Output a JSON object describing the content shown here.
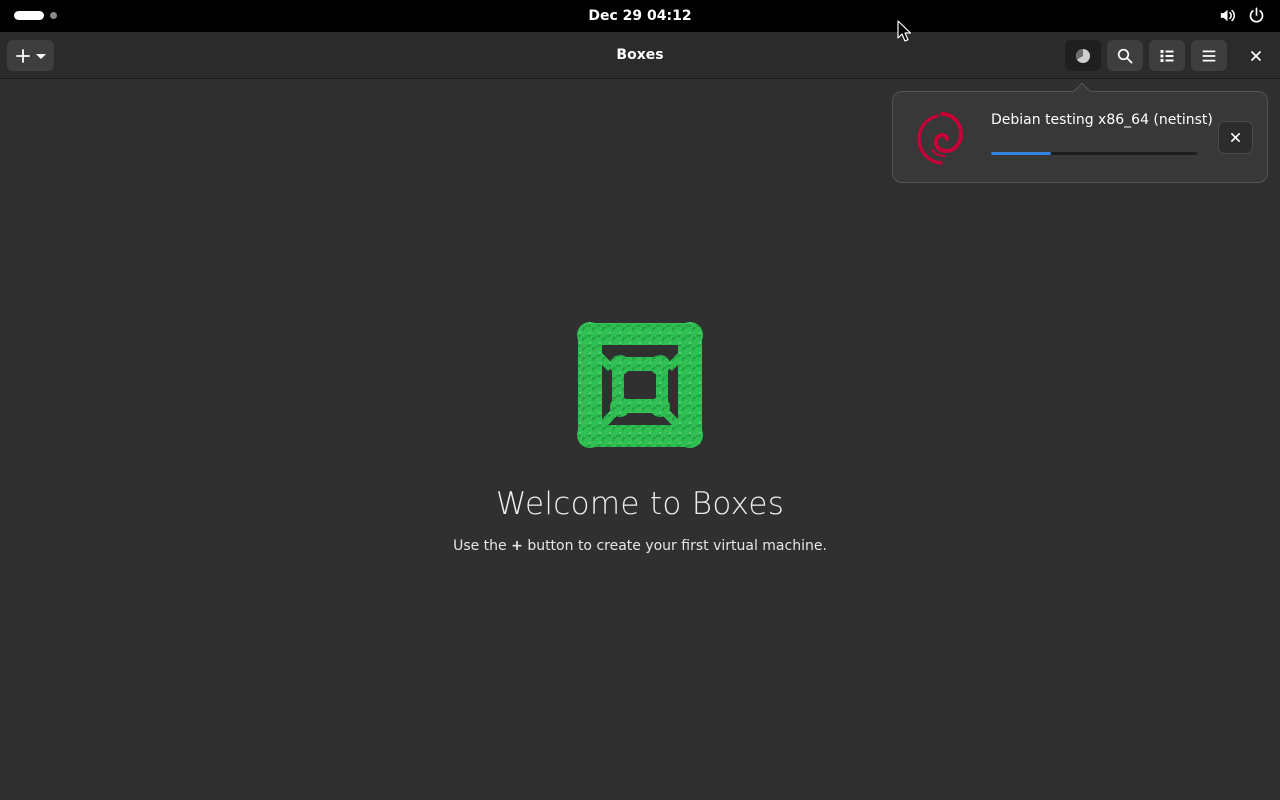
{
  "topbar": {
    "clock": "Dec 29  04:12",
    "icons": [
      "workspace-indicator",
      "volume-icon",
      "power-icon"
    ]
  },
  "headerbar": {
    "title": "Boxes",
    "new_button_icons": [
      "plus-icon",
      "chevron-down-icon"
    ],
    "right_buttons": [
      "downloads-icon",
      "search-icon",
      "list-view-icon",
      "hamburger-menu-icon",
      "close-icon"
    ]
  },
  "downloads": {
    "items": [
      {
        "name": "Debian testing x86_64 (netinst)",
        "progress": 0.29,
        "os_icon": "debian-swirl-icon",
        "cancel_icon": "close-icon"
      }
    ]
  },
  "empty_state": {
    "title": "Welcome to Boxes",
    "desc_before": "Use the",
    "desc_strong": "+",
    "desc_after": "button to create your first virtual machine."
  },
  "colors": {
    "window_bg": "#303030",
    "headerbar_bg": "#2b2b2b",
    "topbar_bg": "#000000",
    "popover_bg": "#383838",
    "accent": "#3584e4",
    "debian_red": "#c70036",
    "logo_green": "#2fbf52"
  }
}
